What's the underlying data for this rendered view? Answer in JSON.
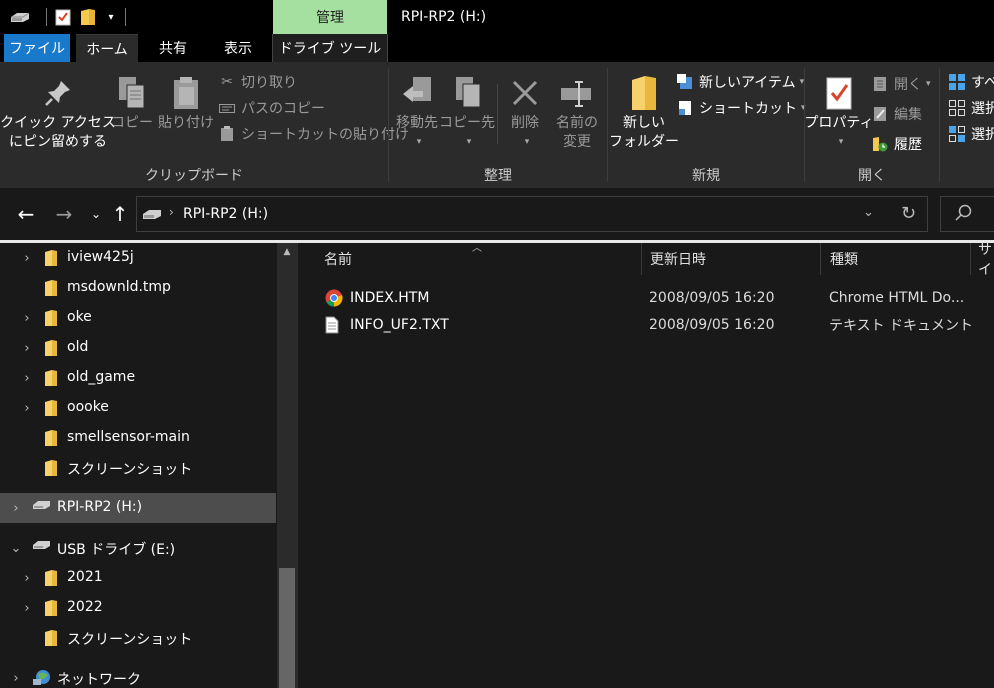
{
  "window": {
    "title": "RPI-RP2 (H:)",
    "contextual_tab": "管理"
  },
  "tabs": {
    "file": "ファイル",
    "home": "ホーム",
    "share": "共有",
    "view": "表示",
    "drive_tools": "ドライブ ツール"
  },
  "ribbon": {
    "clipboard": {
      "group_label": "クリップボード",
      "pin_line1": "クイック アクセス",
      "pin_line2": "にピン留めする",
      "copy": "コピー",
      "paste": "貼り付け",
      "cut": "切り取り",
      "copy_path": "パスのコピー",
      "paste_shortcut": "ショートカットの貼り付け"
    },
    "organize": {
      "group_label": "整理",
      "move_to_line1": "移動先",
      "copy_to_line1": "コピー先",
      "delete": "削除",
      "rename_line1": "名前の",
      "rename_line2": "変更"
    },
    "new": {
      "group_label": "新規",
      "new_folder_line1": "新しい",
      "new_folder_line2": "フォルダー",
      "new_item": "新しいアイテム",
      "shortcut": "ショートカット"
    },
    "open": {
      "group_label": "開く",
      "properties": "プロパティ",
      "open": "開く",
      "edit": "編集",
      "history": "履歴"
    },
    "select": {
      "select_all": "すべ",
      "select_none": "選択",
      "invert": "選択"
    }
  },
  "address": {
    "location": "RPI-RP2 (H:)"
  },
  "nav_tree": [
    {
      "label": "iview425j",
      "chevron": true,
      "icon": "folder-icon",
      "indent": 2
    },
    {
      "label": "msdownld.tmp",
      "chevron": false,
      "icon": "folder-icon",
      "indent": 2
    },
    {
      "label": "oke",
      "chevron": true,
      "icon": "folder-icon",
      "indent": 2
    },
    {
      "label": "old",
      "chevron": true,
      "icon": "folder-icon",
      "indent": 2
    },
    {
      "label": "old_game",
      "chevron": true,
      "icon": "folder-icon",
      "indent": 2
    },
    {
      "label": "oooke",
      "chevron": true,
      "icon": "folder-icon",
      "indent": 2
    },
    {
      "label": "smellsensor-main",
      "chevron": false,
      "icon": "folder-icon",
      "indent": 2
    },
    {
      "label": "スクリーンショット",
      "chevron": false,
      "icon": "folder-icon",
      "indent": 2
    },
    {
      "label": "RPI-RP2 (H:)",
      "chevron": true,
      "icon": "drive-icon",
      "indent": 1,
      "selected": true
    },
    {
      "label": "USB ドライブ (E:)",
      "chevron": "expanded",
      "icon": "drive-icon",
      "indent": 1
    },
    {
      "label": "2021",
      "chevron": true,
      "icon": "folder-icon",
      "indent": 2
    },
    {
      "label": "2022",
      "chevron": true,
      "icon": "folder-icon",
      "indent": 2
    },
    {
      "label": "スクリーンショット",
      "chevron": false,
      "icon": "folder-icon",
      "indent": 2
    },
    {
      "label": "ネットワーク",
      "chevron": true,
      "icon": "network-icon",
      "indent": 1
    }
  ],
  "columns": {
    "name": "名前",
    "modified": "更新日時",
    "type": "種類",
    "size": "サイ"
  },
  "files": [
    {
      "name": "INDEX.HTM",
      "modified": "2008/09/05 16:20",
      "type": "Chrome HTML Do...",
      "icon": "chrome-icon"
    },
    {
      "name": "INFO_UF2.TXT",
      "modified": "2008/09/05 16:20",
      "type": "テキスト ドキュメント",
      "icon": "text-file-icon"
    }
  ]
}
